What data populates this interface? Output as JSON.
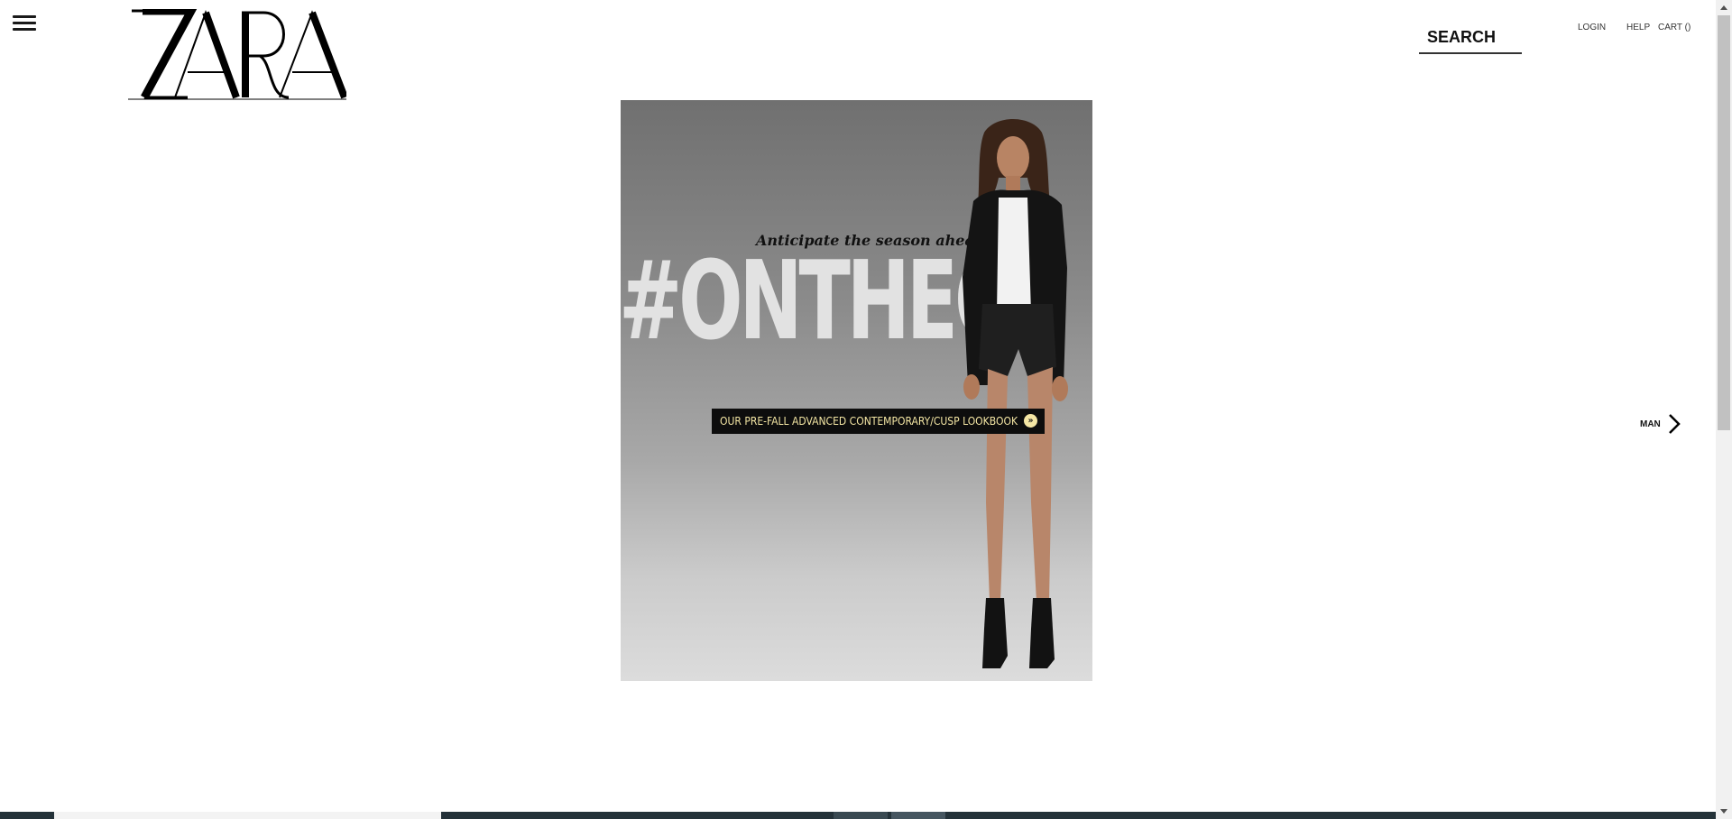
{
  "header": {
    "logo_text": "ZARA",
    "search_placeholder": "SEARCH",
    "links": {
      "login": "LOGIN",
      "help": "HELP",
      "cart": "CART ()"
    }
  },
  "hero": {
    "tagline": "Anticipate the season ahead.",
    "hashtag": "#ONTHEC",
    "banner_text": "OUR PRE-FALL ADVANCED CONTEMPORARY/CUSP LOOKBOOK",
    "banner_arrow": "»"
  },
  "nav": {
    "next_label": "MAN"
  },
  "colors": {
    "banner_bg": "#0d0d0d",
    "banner_text": "#f4e6a4",
    "bottom_bar": "#243239"
  },
  "icons": [
    "menu-icon",
    "chevron-right-icon",
    "scroll-up-icon",
    "scroll-down-icon"
  ]
}
